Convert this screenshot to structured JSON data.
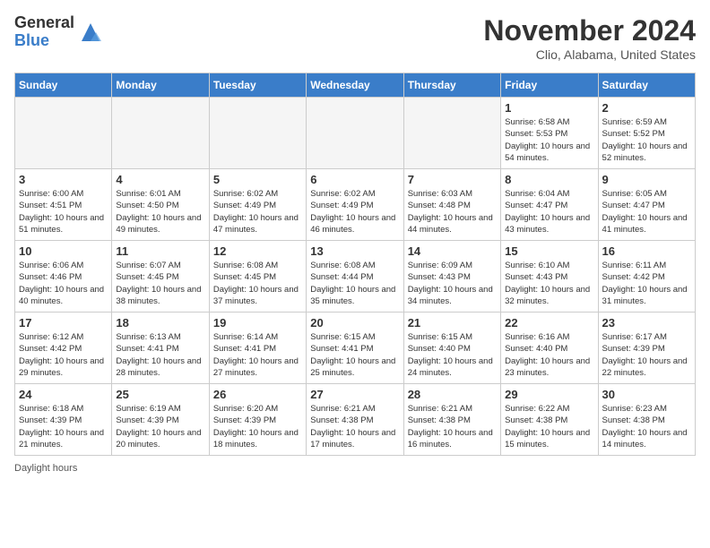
{
  "logo": {
    "general": "General",
    "blue": "Blue"
  },
  "title": "November 2024",
  "location": "Clio, Alabama, United States",
  "footer": "Daylight hours",
  "days_of_week": [
    "Sunday",
    "Monday",
    "Tuesday",
    "Wednesday",
    "Thursday",
    "Friday",
    "Saturday"
  ],
  "weeks": [
    [
      {
        "num": "",
        "detail": "",
        "empty": true
      },
      {
        "num": "",
        "detail": "",
        "empty": true
      },
      {
        "num": "",
        "detail": "",
        "empty": true
      },
      {
        "num": "",
        "detail": "",
        "empty": true
      },
      {
        "num": "",
        "detail": "",
        "empty": true
      },
      {
        "num": "1",
        "detail": "Sunrise: 6:58 AM\nSunset: 5:53 PM\nDaylight: 10 hours\nand 54 minutes.",
        "empty": false
      },
      {
        "num": "2",
        "detail": "Sunrise: 6:59 AM\nSunset: 5:52 PM\nDaylight: 10 hours\nand 52 minutes.",
        "empty": false
      }
    ],
    [
      {
        "num": "3",
        "detail": "Sunrise: 6:00 AM\nSunset: 4:51 PM\nDaylight: 10 hours\nand 51 minutes.",
        "empty": false
      },
      {
        "num": "4",
        "detail": "Sunrise: 6:01 AM\nSunset: 4:50 PM\nDaylight: 10 hours\nand 49 minutes.",
        "empty": false
      },
      {
        "num": "5",
        "detail": "Sunrise: 6:02 AM\nSunset: 4:49 PM\nDaylight: 10 hours\nand 47 minutes.",
        "empty": false
      },
      {
        "num": "6",
        "detail": "Sunrise: 6:02 AM\nSunset: 4:49 PM\nDaylight: 10 hours\nand 46 minutes.",
        "empty": false
      },
      {
        "num": "7",
        "detail": "Sunrise: 6:03 AM\nSunset: 4:48 PM\nDaylight: 10 hours\nand 44 minutes.",
        "empty": false
      },
      {
        "num": "8",
        "detail": "Sunrise: 6:04 AM\nSunset: 4:47 PM\nDaylight: 10 hours\nand 43 minutes.",
        "empty": false
      },
      {
        "num": "9",
        "detail": "Sunrise: 6:05 AM\nSunset: 4:47 PM\nDaylight: 10 hours\nand 41 minutes.",
        "empty": false
      }
    ],
    [
      {
        "num": "10",
        "detail": "Sunrise: 6:06 AM\nSunset: 4:46 PM\nDaylight: 10 hours\nand 40 minutes.",
        "empty": false
      },
      {
        "num": "11",
        "detail": "Sunrise: 6:07 AM\nSunset: 4:45 PM\nDaylight: 10 hours\nand 38 minutes.",
        "empty": false
      },
      {
        "num": "12",
        "detail": "Sunrise: 6:08 AM\nSunset: 4:45 PM\nDaylight: 10 hours\nand 37 minutes.",
        "empty": false
      },
      {
        "num": "13",
        "detail": "Sunrise: 6:08 AM\nSunset: 4:44 PM\nDaylight: 10 hours\nand 35 minutes.",
        "empty": false
      },
      {
        "num": "14",
        "detail": "Sunrise: 6:09 AM\nSunset: 4:43 PM\nDaylight: 10 hours\nand 34 minutes.",
        "empty": false
      },
      {
        "num": "15",
        "detail": "Sunrise: 6:10 AM\nSunset: 4:43 PM\nDaylight: 10 hours\nand 32 minutes.",
        "empty": false
      },
      {
        "num": "16",
        "detail": "Sunrise: 6:11 AM\nSunset: 4:42 PM\nDaylight: 10 hours\nand 31 minutes.",
        "empty": false
      }
    ],
    [
      {
        "num": "17",
        "detail": "Sunrise: 6:12 AM\nSunset: 4:42 PM\nDaylight: 10 hours\nand 29 minutes.",
        "empty": false
      },
      {
        "num": "18",
        "detail": "Sunrise: 6:13 AM\nSunset: 4:41 PM\nDaylight: 10 hours\nand 28 minutes.",
        "empty": false
      },
      {
        "num": "19",
        "detail": "Sunrise: 6:14 AM\nSunset: 4:41 PM\nDaylight: 10 hours\nand 27 minutes.",
        "empty": false
      },
      {
        "num": "20",
        "detail": "Sunrise: 6:15 AM\nSunset: 4:41 PM\nDaylight: 10 hours\nand 25 minutes.",
        "empty": false
      },
      {
        "num": "21",
        "detail": "Sunrise: 6:15 AM\nSunset: 4:40 PM\nDaylight: 10 hours\nand 24 minutes.",
        "empty": false
      },
      {
        "num": "22",
        "detail": "Sunrise: 6:16 AM\nSunset: 4:40 PM\nDaylight: 10 hours\nand 23 minutes.",
        "empty": false
      },
      {
        "num": "23",
        "detail": "Sunrise: 6:17 AM\nSunset: 4:39 PM\nDaylight: 10 hours\nand 22 minutes.",
        "empty": false
      }
    ],
    [
      {
        "num": "24",
        "detail": "Sunrise: 6:18 AM\nSunset: 4:39 PM\nDaylight: 10 hours\nand 21 minutes.",
        "empty": false
      },
      {
        "num": "25",
        "detail": "Sunrise: 6:19 AM\nSunset: 4:39 PM\nDaylight: 10 hours\nand 20 minutes.",
        "empty": false
      },
      {
        "num": "26",
        "detail": "Sunrise: 6:20 AM\nSunset: 4:39 PM\nDaylight: 10 hours\nand 18 minutes.",
        "empty": false
      },
      {
        "num": "27",
        "detail": "Sunrise: 6:21 AM\nSunset: 4:38 PM\nDaylight: 10 hours\nand 17 minutes.",
        "empty": false
      },
      {
        "num": "28",
        "detail": "Sunrise: 6:21 AM\nSunset: 4:38 PM\nDaylight: 10 hours\nand 16 minutes.",
        "empty": false
      },
      {
        "num": "29",
        "detail": "Sunrise: 6:22 AM\nSunset: 4:38 PM\nDaylight: 10 hours\nand 15 minutes.",
        "empty": false
      },
      {
        "num": "30",
        "detail": "Sunrise: 6:23 AM\nSunset: 4:38 PM\nDaylight: 10 hours\nand 14 minutes.",
        "empty": false
      }
    ]
  ]
}
